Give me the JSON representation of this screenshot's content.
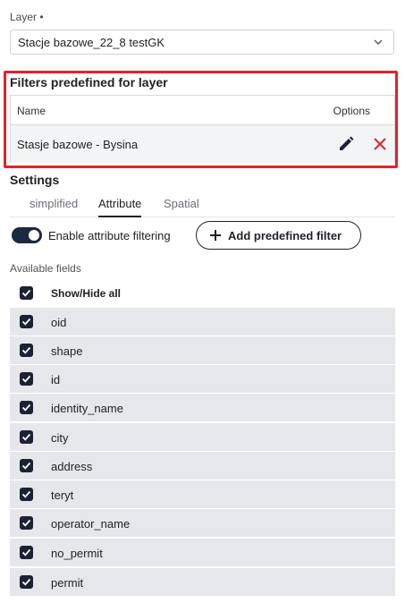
{
  "layer": {
    "label": "Layer •",
    "selected": "Stacje bazowe_22_8 testGK"
  },
  "filters": {
    "title": "Filters predefined for layer",
    "col_name": "Name",
    "col_options": "Options",
    "rows": [
      {
        "name": "Stasje bazowe - Bysina"
      }
    ],
    "highlight_color": "#e8202a",
    "delete_color": "#d9262c"
  },
  "settings": {
    "title": "Settings",
    "tabs": [
      {
        "label": "simplified",
        "active": false
      },
      {
        "label": "Attribute",
        "active": true
      },
      {
        "label": "Spatial",
        "active": false
      }
    ],
    "toggle_label": "Enable attribute filtering",
    "toggle_on": true,
    "add_button": "Add predefined filter"
  },
  "fields": {
    "label": "Available fields",
    "show_hide_all": "Show/Hide all",
    "items": [
      {
        "name": "oid",
        "checked": true
      },
      {
        "name": "shape",
        "checked": true
      },
      {
        "name": "id",
        "checked": true
      },
      {
        "name": "identity_name",
        "checked": true
      },
      {
        "name": "city",
        "checked": true
      },
      {
        "name": "address",
        "checked": true
      },
      {
        "name": "teryt",
        "checked": true
      },
      {
        "name": "operator_name",
        "checked": true
      },
      {
        "name": "no_permit",
        "checked": true
      },
      {
        "name": "permit",
        "checked": true
      }
    ]
  },
  "icons": {
    "select_arrow": "chevron-down-icon",
    "edit": "pencil-icon",
    "delete": "close-icon",
    "add": "plus-icon",
    "checkbox": "check-icon"
  },
  "colors": {
    "accent_dark": "#1b2233",
    "row_shade": "#e6e7ea"
  }
}
